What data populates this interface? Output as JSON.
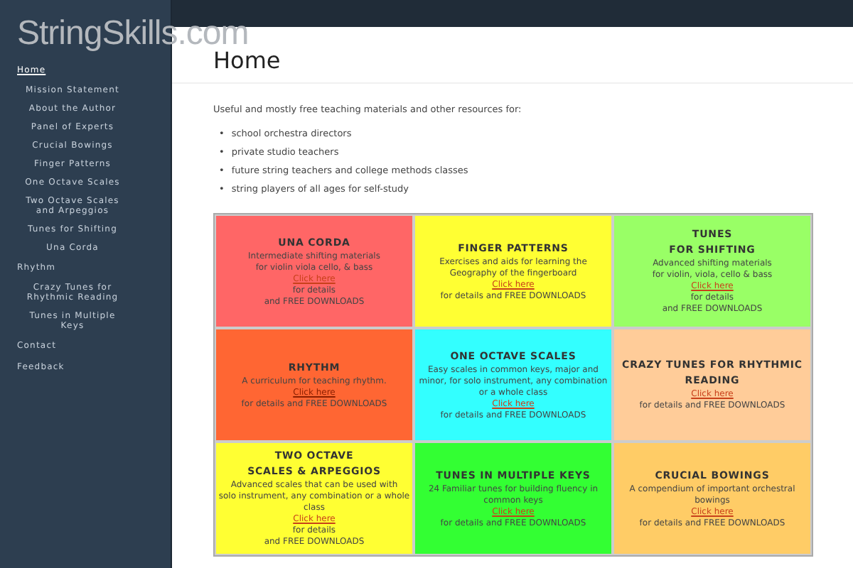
{
  "logo": "StringSkills.com",
  "sidebar": {
    "items": [
      {
        "label": "Home",
        "selected": true,
        "children": [
          {
            "label": "Mission Statement",
            "selected": false
          },
          {
            "label": "About the Author",
            "selected": false
          },
          {
            "label": "Panel of Experts",
            "selected": false
          },
          {
            "label": "Crucial Bowings",
            "selected": false
          },
          {
            "label": "Finger Patterns",
            "selected": false
          },
          {
            "label": "One Octave Scales",
            "selected": false
          },
          {
            "label": "Two Octave Scales and Arpeggios",
            "selected": false
          },
          {
            "label": "Tunes for Shifting",
            "selected": false
          },
          {
            "label": "Una Corda",
            "selected": false
          }
        ]
      },
      {
        "label": "Rhythm",
        "selected": false,
        "children": [
          {
            "label": "Crazy Tunes for Rhythmic Reading",
            "selected": false
          },
          {
            "label": "Tunes in Multiple Keys",
            "selected": false
          }
        ]
      },
      {
        "label": "Contact",
        "selected": false
      },
      {
        "label": "Feedback",
        "selected": false
      }
    ]
  },
  "page": {
    "title": "Home",
    "intro": "Useful and mostly free teaching materials and other resources for:",
    "audiences": [
      {
        "marker": "•",
        "text": "school orchestra directors"
      },
      {
        "marker": "•",
        "text": "private studio teachers"
      },
      {
        "marker": "•",
        "text": "future string teachers and college methods classes"
      },
      {
        "marker": "•",
        "text": "string players of all ages for self-study"
      }
    ]
  },
  "cards": [
    {
      "title": "UNA CORDA",
      "color": "#ff6666",
      "description": "Intermediate shifting materials\nfor violin viola cello, & bass",
      "link": "Click here",
      "details": "for details\nand FREE DOWNLOADS"
    },
    {
      "title": "FINGER PATTERNS",
      "color": "#ffff33",
      "description": "Exercises and aids for learning the\nGeography of the fingerboard",
      "link": "Click here",
      "details": "for details and FREE DOWNLOADS"
    },
    {
      "title": "TUNES\nFOR SHIFTING",
      "color": "#99ff66",
      "description": "Advanced shifting materials\nfor violin, viola, cello & bass",
      "link": "Click here",
      "details": "for details\nand FREE DOWNLOADS"
    },
    {
      "title": "RHYTHM",
      "color": "#ff6633",
      "description": "A curriculum for teaching rhythm.",
      "link": "Click here",
      "details": "for details and FREE DOWNLOADS"
    },
    {
      "title": "ONE OCTAVE SCALES",
      "color": "#33ffff",
      "description": "Easy scales in common keys, major and\nminor, for solo instrument, any combination\nor a whole class",
      "link": "Click here",
      "details": "for details and FREE DOWNLOADS"
    },
    {
      "title": "CRAZY TUNES FOR RHYTHMIC\nREADING",
      "color": "#ffcc99",
      "link": "Click here",
      "details": "for details and FREE DOWNLOADS"
    },
    {
      "title": "TWO OCTAVE\nSCALES & ARPEGGIOS",
      "color": "#ffff33",
      "description": "Advanced scales that can be used with\nsolo instrument, any combination or a whole\nclass",
      "link": "Click here",
      "details": "for details\nand FREE DOWNLOADS"
    },
    {
      "title": "TUNES IN MULTIPLE KEYS",
      "color": "#33ff33",
      "description": "24 Familiar tunes for building fluency in\ncommon keys",
      "link": "Click here",
      "details": "for details and FREE DOWNLOADS"
    },
    {
      "title": "CRUCIAL BOWINGS",
      "color": "#ffcc66",
      "description": "A compendium of important orchestral\nbowings",
      "link": "Click here",
      "details": "for details and FREE DOWNLOADS"
    }
  ]
}
